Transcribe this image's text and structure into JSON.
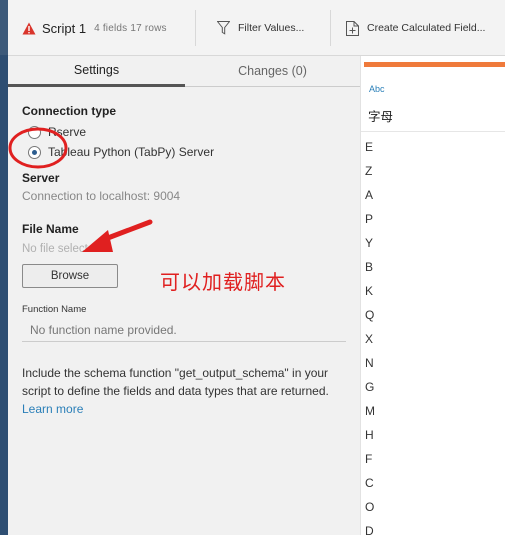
{
  "toolbar": {
    "script_title": "Script 1",
    "script_meta": "4 fields  17 rows",
    "filter_label": "Filter Values...",
    "calc_label": "Create Calculated Field..."
  },
  "tabs": {
    "settings": "Settings",
    "changes": "Changes (0)"
  },
  "settings": {
    "connection_type_label": "Connection type",
    "options": [
      {
        "label": "Rserve",
        "selected": false
      },
      {
        "label": "Tableau Python (TabPy) Server",
        "selected": true
      }
    ],
    "server_label": "Server",
    "server_value": "Connection to localhost: 9004",
    "file_name_label": "File Name",
    "file_name_placeholder": "No file selected",
    "browse_label": "Browse",
    "function_name_label": "Function Name",
    "function_name_placeholder": "No function name provided.",
    "help_text": "Include the schema function \"get_output_schema\" in your script to define the fields and data types that are returned.",
    "learn_more": "Learn more"
  },
  "annotation": {
    "text": "可以加载脚本",
    "color": "#e02020"
  },
  "data_panel": {
    "type_label": "Abc",
    "column_name": "字母",
    "values": [
      "E",
      "Z",
      "A",
      "P",
      "Y",
      "B",
      "K",
      "Q",
      "X",
      "N",
      "G",
      "M",
      "H",
      "F",
      "C",
      "O",
      "D"
    ]
  },
  "colors": {
    "accent_bar": "#ef7a3b",
    "warning_icon": "#d9342b",
    "link": "#2a7fb8"
  }
}
